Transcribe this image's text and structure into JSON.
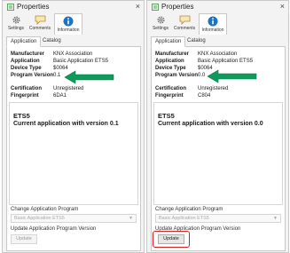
{
  "panels": [
    {
      "title": "Properties",
      "toolbar": [
        {
          "label": "Settings",
          "icon": "gear-icon"
        },
        {
          "label": "Comments",
          "icon": "comment-icon"
        },
        {
          "label": "Information",
          "icon": "info-icon"
        }
      ],
      "tabs": [
        "Application",
        "Catalog"
      ],
      "properties": [
        {
          "label": "Manufacturer",
          "value": "KNX Association"
        },
        {
          "label": "Application",
          "value": "Basic Application ETS5"
        },
        {
          "label": "Device Type",
          "value": "$0064"
        },
        {
          "label": "Program Version",
          "value": "0.1"
        },
        {
          "label": "Certification",
          "value": "Unregistered"
        },
        {
          "label": "Fingerprint",
          "value": "6DA1"
        }
      ],
      "description": {
        "line1": "ETS5",
        "line2": "Current application with version 0.1"
      },
      "change_label": "Change Application Program",
      "select_value": "Basic Application ETS5",
      "update_label": "Update Application Program Version",
      "update_button": "Update"
    },
    {
      "title": "Properties",
      "toolbar": [
        {
          "label": "Settings",
          "icon": "gear-icon"
        },
        {
          "label": "Comments",
          "icon": "comment-icon"
        },
        {
          "label": "Information",
          "icon": "info-icon"
        }
      ],
      "tabs": [
        "Application",
        "Catalog"
      ],
      "properties": [
        {
          "label": "Manufacturer",
          "value": "KNX Association"
        },
        {
          "label": "Application",
          "value": "Basic Application ETS5"
        },
        {
          "label": "Device Type",
          "value": "$0064"
        },
        {
          "label": "Program Version",
          "value": "0.0"
        },
        {
          "label": "Certification",
          "value": "Unregistered"
        },
        {
          "label": "Fingerprint",
          "value": "C804"
        }
      ],
      "description": {
        "line1": "ETS5",
        "line2": "Current application with version 0.0"
      },
      "change_label": "Change Application Program",
      "select_value": "Basic Application ETS5",
      "update_label": "Update Application Program Version",
      "update_button": "Update"
    }
  ],
  "colors": {
    "arrow": "#0e9a5a",
    "highlight": "#d61f1f",
    "info_icon": "#1c73c4",
    "title_icon": "#3a8f3a"
  }
}
